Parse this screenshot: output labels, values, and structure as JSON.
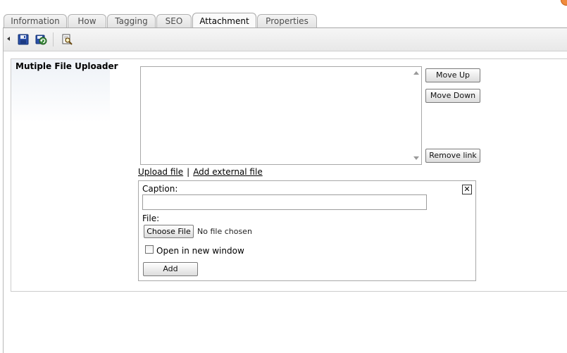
{
  "tabs": [
    {
      "label": "Information",
      "active": false
    },
    {
      "label": "How",
      "active": false
    },
    {
      "label": "Tagging",
      "active": false
    },
    {
      "label": "SEO",
      "active": false
    },
    {
      "label": "Attachment",
      "active": true
    },
    {
      "label": "Properties",
      "active": false
    }
  ],
  "toolbar": {
    "icons": [
      "save-icon",
      "save-and-close-icon",
      "preview-icon"
    ]
  },
  "uploader": {
    "label": "Mutiple File Uploader",
    "move_up": "Move Up",
    "move_down": "Move Down",
    "remove_link": "Remove link",
    "upload_file_link": "Upload file",
    "separator": "|",
    "add_external_link": "Add external file",
    "close_glyph": "✕",
    "caption_label": "Caption:",
    "caption_value": "",
    "file_label": "File:",
    "choose_file": "Choose File",
    "file_status": "No file chosen",
    "open_new_window_label": "Open in new window",
    "open_new_window_checked": false,
    "add_button": "Add"
  },
  "colors": {
    "accent_corner": "#f08a3c",
    "border": "#a8a8a8"
  }
}
